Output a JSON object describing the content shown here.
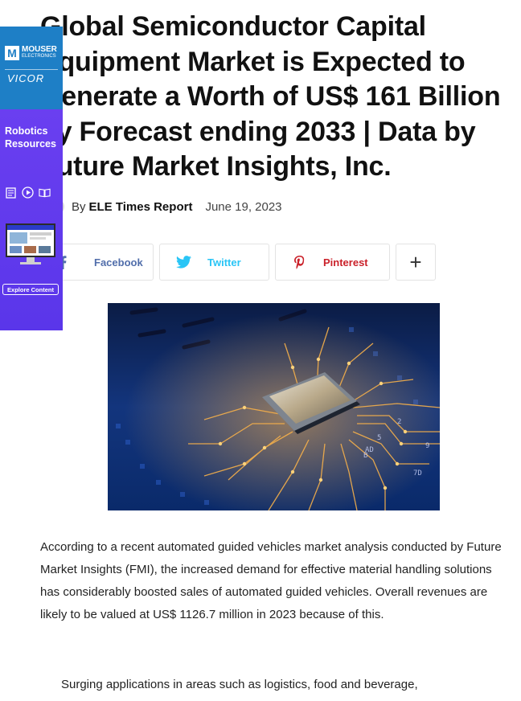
{
  "article": {
    "title": "Global Semiconductor Capital Equipment Market is Expected to Generate a Worth of US$ 161 Billion by Forecast ending 2033 | Data by Future Market Insights, Inc.",
    "by_label": "By",
    "author": "ELE Times Report",
    "date": "June 19, 2023",
    "paragraph_1": "According to a recent automated guided vehicles market analysis conducted by Future Market Insights (FMI), the increased demand for effective material handling solutions has considerably boosted sales of automated guided vehicles. Overall revenues are likely to be valued at US$ 1126.7 million in 2023 because of this.",
    "paragraph_2": "Surging applications in areas such as logistics, food and beverage,"
  },
  "share": {
    "facebook": "Facebook",
    "twitter": "Twitter",
    "pinterest": "Pinterest",
    "more": "+"
  },
  "ad": {
    "brand_1": "MOUSER",
    "brand_1_sub": "ELECTRONICS",
    "brand_2": "VICOR",
    "headline": "Robotics Resources",
    "cta": "Explore Content"
  },
  "colors": {
    "facebook": "#516eab",
    "twitter": "#29c5f6",
    "pinterest": "#ca212a",
    "ad_blue": "#1e7fc6",
    "ad_purple": "#6a3ff0"
  },
  "icons": [
    "facebook-icon",
    "twitter-icon",
    "pinterest-icon",
    "plus-icon",
    "mouser-logo",
    "doc-icon",
    "play-icon",
    "book-icon"
  ]
}
